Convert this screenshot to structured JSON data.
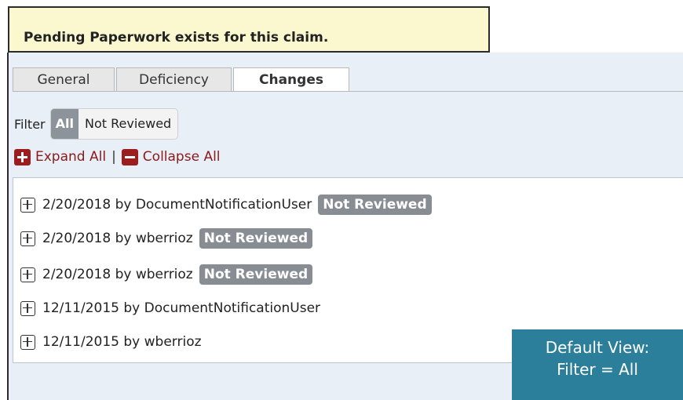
{
  "notice": {
    "text": "Pending Paperwork exists for this claim."
  },
  "tabs": [
    {
      "label": "General",
      "active": false
    },
    {
      "label": "Deficiency",
      "active": false
    },
    {
      "label": "Changes",
      "active": true
    }
  ],
  "filter": {
    "label": "Filter",
    "options": [
      {
        "label": "All",
        "selected": true
      },
      {
        "label": "Not Reviewed",
        "selected": false
      }
    ]
  },
  "expand_controls": {
    "expand_label": "Expand All",
    "separator": "|",
    "collapse_label": "Collapse All"
  },
  "changes": [
    {
      "date": "2/20/2018",
      "by": "by",
      "user": "DocumentNotificationUser",
      "badge": "Not Reviewed"
    },
    {
      "date": "2/20/2018",
      "by": "by",
      "user": "wberrioz",
      "badge": "Not Reviewed"
    },
    {
      "date": "2/20/2018",
      "by": "by",
      "user": "wberrioz",
      "badge": "Not Reviewed"
    },
    {
      "date": "12/11/2015",
      "by": "by",
      "user": "DocumentNotificationUser",
      "badge": ""
    },
    {
      "date": "12/11/2015",
      "by": "by",
      "user": "wberrioz",
      "badge": ""
    }
  ],
  "callout": {
    "line1": "Default View:",
    "line2": "Filter = All"
  },
  "colors": {
    "notice_bg": "#fbf8cf",
    "badge_bg": "#888d93",
    "filter_active_bg": "#8c939a",
    "expand_red": "#9b1d1d",
    "callout_bg": "#2b7f9a"
  }
}
